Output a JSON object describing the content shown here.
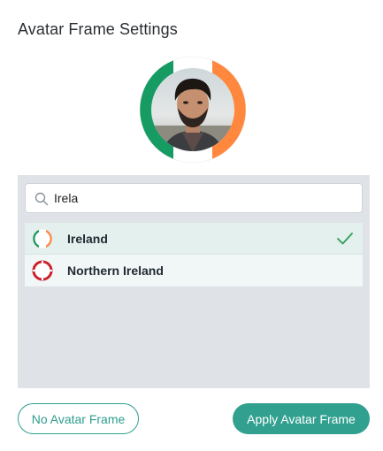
{
  "dialog": {
    "title": "Avatar Frame Settings"
  },
  "avatar": {
    "frame": "Ireland",
    "frame_colors": [
      "#169b62",
      "#ffffff",
      "#ff883e"
    ]
  },
  "search": {
    "value": "Irela",
    "icon": "search-icon"
  },
  "results": [
    {
      "label": "Ireland",
      "selected": true,
      "flag_icon": "ireland-flag-frame-icon"
    },
    {
      "label": "Northern Ireland",
      "selected": false,
      "flag_icon": "northern-ireland-flag-frame-icon"
    }
  ],
  "buttons": {
    "no_frame": "No Avatar Frame",
    "apply": "Apply Avatar Frame"
  },
  "colors": {
    "accent": "#31a08f",
    "panel": "#dfe2e6",
    "selected_row": "#e4f0ee",
    "check": "#2f9e55"
  }
}
